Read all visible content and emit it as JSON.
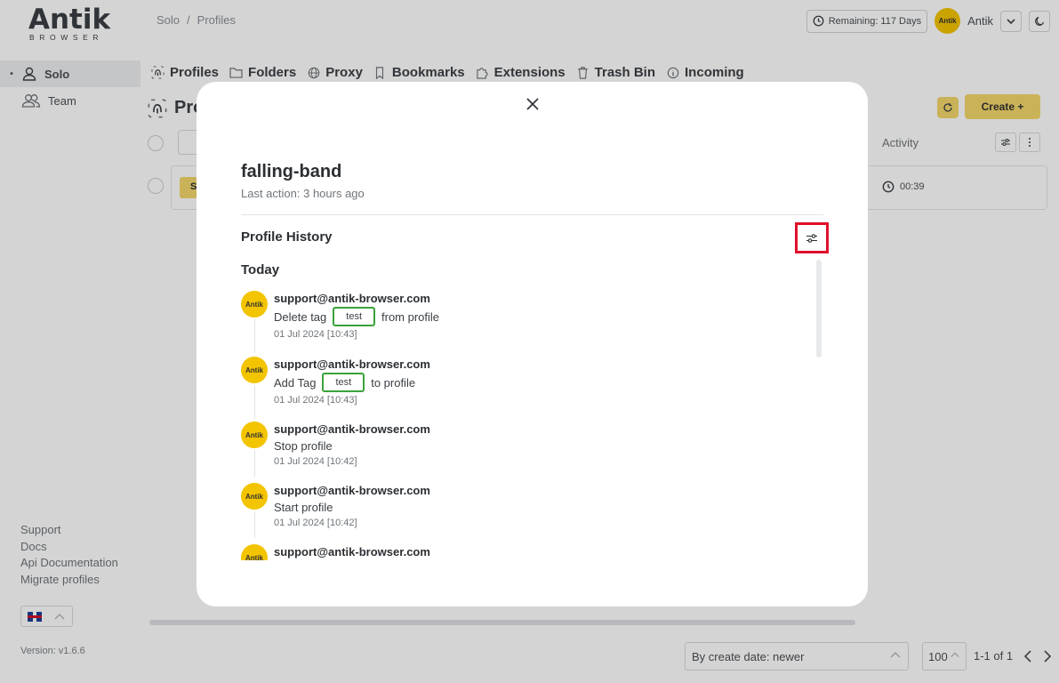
{
  "app": {
    "logo_text": "Antik",
    "logo_sub": "BROWSER"
  },
  "breadcrumb": [
    "Solo",
    "Profiles"
  ],
  "header": {
    "remaining": "Remaining: 117 Days",
    "avatar_text": "Antik",
    "user_name": "Antik"
  },
  "sidebar": {
    "items": [
      {
        "label": "Solo",
        "icon": "user-icon",
        "active": true
      },
      {
        "label": "Team",
        "icon": "users-icon",
        "active": false
      }
    ],
    "links": [
      "Support",
      "Docs",
      "Api Documentation",
      "Migrate profiles"
    ],
    "version": "Version: v1.6.6"
  },
  "tabs": [
    {
      "label": "Profiles",
      "icon": "fingerprint-icon"
    },
    {
      "label": "Folders",
      "icon": "folder-icon"
    },
    {
      "label": "Proxy",
      "icon": "globe-icon"
    },
    {
      "label": "Bookmarks",
      "icon": "bookmark-icon"
    },
    {
      "label": "Extensions",
      "icon": "puzzle-icon"
    },
    {
      "label": "Trash Bin",
      "icon": "trash-icon"
    },
    {
      "label": "Incoming",
      "icon": "info-icon"
    }
  ],
  "page": {
    "title": "Pro",
    "create_label": "Create +",
    "activity_col": "Activity",
    "row_time": "00:39",
    "row_tag": "S"
  },
  "footer": {
    "sort": "By create date: newer",
    "per_page": "100",
    "range": "1-1 of 1"
  },
  "modal": {
    "title": "falling-band",
    "subtitle": "Last action: 3 hours ago",
    "section": "Profile History",
    "group": "Today",
    "entries": [
      {
        "user": "support@antik-browser.com",
        "before": "Delete tag",
        "tag": "test",
        "after": "from profile",
        "time": "01 Jul 2024 [10:43]"
      },
      {
        "user": "support@antik-browser.com",
        "before": "Add Tag",
        "tag": "test",
        "after": "to profile",
        "time": "01 Jul 2024 [10:43]"
      },
      {
        "user": "support@antik-browser.com",
        "before": "Stop profile",
        "tag": "",
        "after": "",
        "time": "01 Jul 2024 [10:42]"
      },
      {
        "user": "support@antik-browser.com",
        "before": "Start profile",
        "tag": "",
        "after": "",
        "time": "01 Jul 2024 [10:42]"
      },
      {
        "user": "support@antik-browser.com",
        "before": "",
        "tag": "",
        "after": "",
        "time": ""
      }
    ]
  },
  "colors": {
    "accent": "#f3c400",
    "button_bg": "#f3d76b",
    "tag_border": "#3aa23a",
    "highlight": "#e0102b"
  }
}
